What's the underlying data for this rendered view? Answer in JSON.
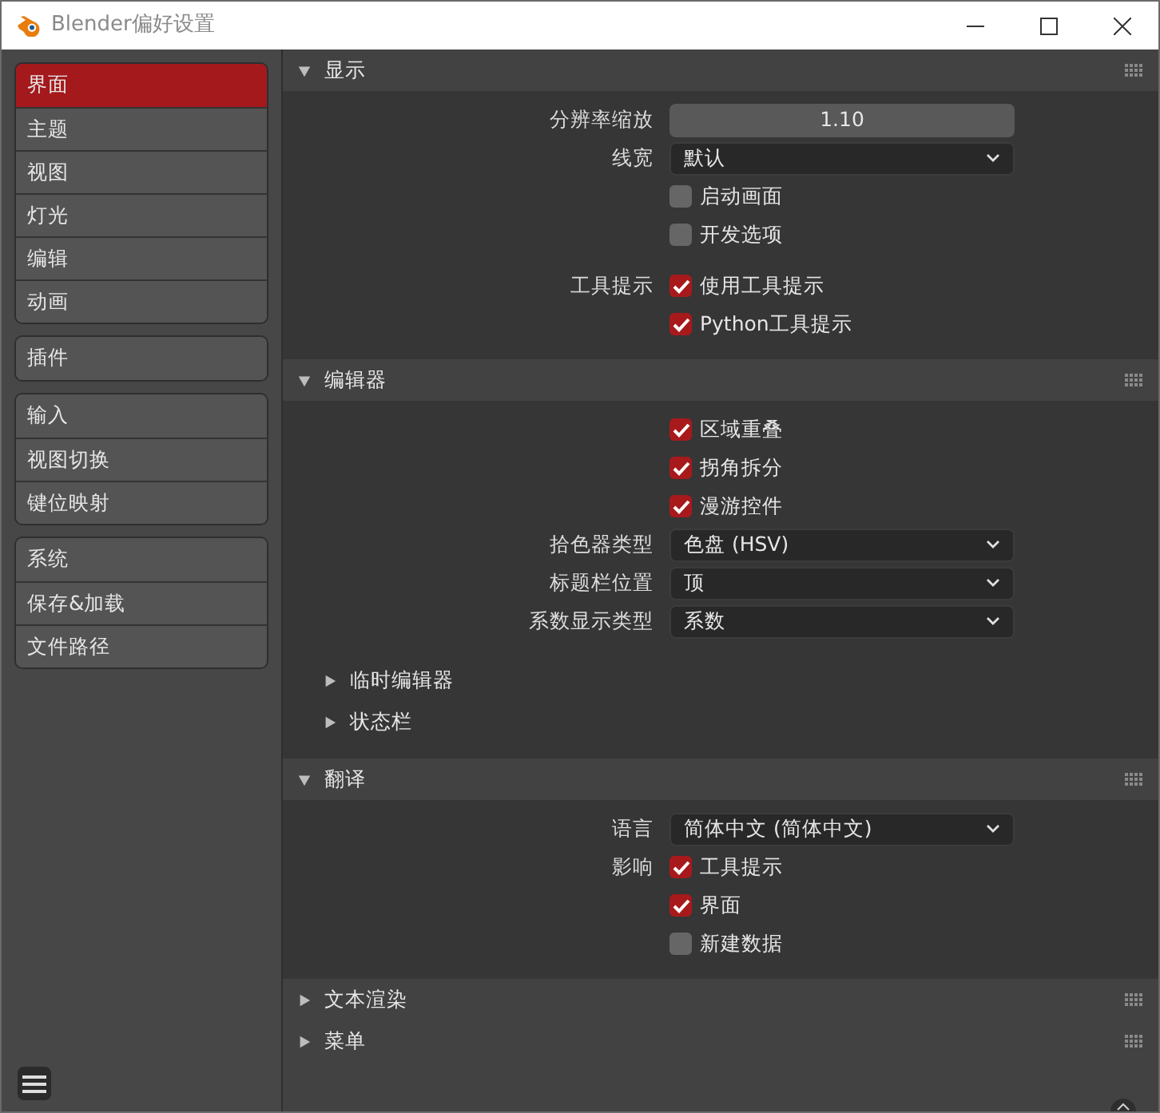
{
  "window": {
    "title": "Blender偏好设置"
  },
  "sidebar": {
    "groups": [
      [
        {
          "label": "界面",
          "selected": true
        },
        {
          "label": "主题",
          "selected": false
        },
        {
          "label": "视图",
          "selected": false
        },
        {
          "label": "灯光",
          "selected": false
        },
        {
          "label": "编辑",
          "selected": false
        },
        {
          "label": "动画",
          "selected": false
        }
      ],
      [
        {
          "label": "插件",
          "selected": false
        }
      ],
      [
        {
          "label": "输入",
          "selected": false
        },
        {
          "label": "视图切换",
          "selected": false
        },
        {
          "label": "键位映射",
          "selected": false
        }
      ],
      [
        {
          "label": "系统",
          "selected": false
        },
        {
          "label": "保存&加载",
          "selected": false
        },
        {
          "label": "文件路径",
          "selected": false
        }
      ]
    ]
  },
  "sections": [
    {
      "title": "显示",
      "expanded": true,
      "groups": [
        [
          {
            "kind": "number",
            "label": "分辨率缩放",
            "value": "1.10"
          },
          {
            "kind": "dropdown",
            "label": "线宽",
            "value": "默认"
          },
          {
            "kind": "checkbox",
            "text": "启动画面",
            "checked": false
          },
          {
            "kind": "checkbox",
            "text": "开发选项",
            "checked": false
          }
        ],
        [
          {
            "kind": "checkbox",
            "label": "工具提示",
            "text": "使用工具提示",
            "checked": true
          },
          {
            "kind": "checkbox",
            "text": "Python工具提示",
            "checked": true
          }
        ]
      ]
    },
    {
      "title": "编辑器",
      "expanded": true,
      "groups": [
        [
          {
            "kind": "checkbox",
            "text": "区域重叠",
            "checked": true
          },
          {
            "kind": "checkbox",
            "text": "拐角拆分",
            "checked": true
          },
          {
            "kind": "checkbox",
            "text": "漫游控件",
            "checked": true
          },
          {
            "kind": "dropdown",
            "label": "拾色器类型",
            "value": "色盘 (HSV)"
          },
          {
            "kind": "dropdown",
            "label": "标题栏位置",
            "value": "顶"
          },
          {
            "kind": "dropdown",
            "label": "系数显示类型",
            "value": "系数"
          }
        ]
      ],
      "subpanels": [
        {
          "title": "临时编辑器",
          "expanded": false
        },
        {
          "title": "状态栏",
          "expanded": false
        }
      ]
    },
    {
      "title": "翻译",
      "expanded": true,
      "groups": [
        [
          {
            "kind": "dropdown",
            "label": "语言",
            "value": "简体中文 (简体中文)"
          },
          {
            "kind": "checkbox",
            "label": "影响",
            "text": "工具提示",
            "checked": true
          },
          {
            "kind": "checkbox",
            "text": "界面",
            "checked": true
          },
          {
            "kind": "checkbox",
            "text": "新建数据",
            "checked": false
          }
        ]
      ]
    },
    {
      "title": "文本渲染",
      "expanded": false
    },
    {
      "title": "菜单",
      "expanded": false
    }
  ]
}
